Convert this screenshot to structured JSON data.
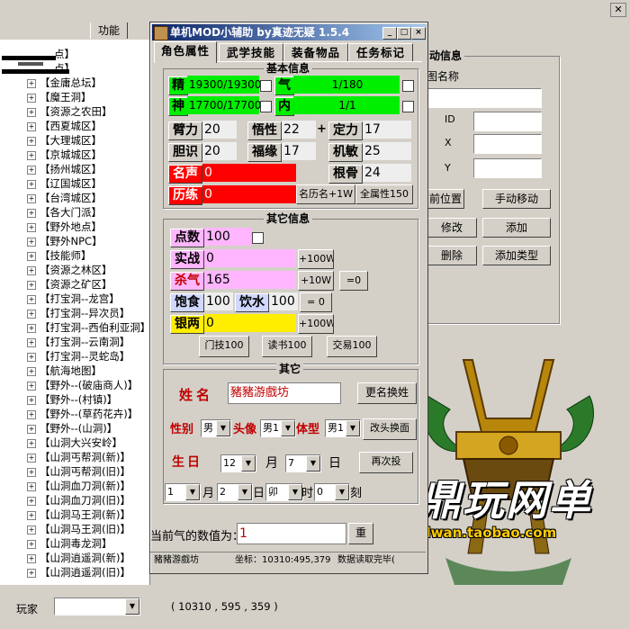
{
  "background_app": {
    "menu": {
      "func_tab": "功能"
    },
    "tree_items": [
      "点】",
      "点】",
      "【金庸总坛】",
      "【魔王洞】",
      "【资源之农田】",
      "【西夏城区】",
      "【大理城区】",
      "【京城城区】",
      "【扬州城区】",
      "【辽国城区】",
      "【台湾城区】",
      "【各大门派】",
      "【野外地点】",
      "【野外NPC】",
      "【技能师】",
      "【资源之林区】",
      "【资源之矿区】",
      "【打宝洞--龙宫】",
      "【打宝洞--异次员】",
      "【打宝洞--西伯利亚洞】",
      "【打宝洞--云南洞】",
      "【打宝洞--灵蛇岛】",
      "【航海地图】",
      "【野外--(破庙商人)】",
      "【野外--(村镇)】",
      "【野外--(草药花卉)】",
      "【野外--(山洞)】",
      "【山洞大兴安岭】",
      "【山洞丐帮洞(新)】",
      "【山洞丐帮洞(旧)】",
      "【山洞血刀洞(新)】",
      "【山洞血刀洞(旧)】",
      "【山洞马王洞(新)】",
      "【山洞马王洞(旧)】",
      "【山洞毒龙洞】",
      "【山洞逍遥洞(新)】",
      "【山洞逍遥洞(旧)】"
    ],
    "right_panel": {
      "group_title": "动信息",
      "name_label": "图名称",
      "id_label": "ID",
      "x_label": "X",
      "y_label": "Y",
      "btn_current_pos": "前位置",
      "btn_manual_move": "手动移动",
      "btn_modify": "修改",
      "btn_add": "添加",
      "btn_delete": "删除",
      "btn_add_type": "添加类型"
    },
    "bottom": {
      "player_label": "玩家",
      "coords": "( 10310 , 595 , 359 )"
    }
  },
  "dialog": {
    "title": "单机MOD小辅助 by真迹无疑 1.5.4",
    "tabs": [
      "角色属性",
      "武学技能",
      "装备物品",
      "任务标记"
    ],
    "basic": {
      "title": "基本信息",
      "jing_label": "精",
      "jing_value": "19300/19300",
      "qi_label": "气",
      "qi_value": "1/180",
      "shen_label": "神",
      "shen_value": "17700/17700",
      "nei_label": "内",
      "nei_value": "1/1",
      "stats": [
        {
          "label": "臂力",
          "value": "20"
        },
        {
          "label": "悟性",
          "value": "22"
        },
        {
          "label": "定力",
          "value": "17"
        },
        {
          "label": "胆识",
          "value": "20"
        },
        {
          "label": "福缘",
          "value": "17"
        },
        {
          "label": "机敏",
          "value": "25"
        }
      ],
      "plus_sign": "+",
      "fame_label": "名声",
      "fame_value": "0",
      "bone_label": "根骨",
      "bone_value": "24",
      "exp_label": "历练",
      "exp_value": "0",
      "btn_fame_exp": "名历名+1W",
      "btn_all_attr": "全属性150"
    },
    "other": {
      "title": "其它信息",
      "points_label": "点数",
      "points_value": "100",
      "combat_label": "实战",
      "combat_value": "0",
      "btn_combat": "+100W",
      "kill_label": "杀气",
      "kill_value": "165",
      "btn_kill": "+10W",
      "btn_kill_zero": "=0",
      "food_label": "饱食",
      "food_value": "100",
      "water_label": "饮水",
      "water_value": "100",
      "btn_food_zero": "= 0",
      "silver_label": "银两",
      "silver_value": "0",
      "btn_silver": "+100W",
      "btn_school": "门技100",
      "btn_read": "读书100",
      "btn_trade": "交易100"
    },
    "misc": {
      "title": "其它",
      "name_label": "姓名",
      "name_value": "豬豬游戲坊",
      "btn_rename": "更名换姓",
      "gender_label": "性别",
      "gender_value": "男",
      "avatar_label": "头像",
      "avatar_value": "男1",
      "body_label": "体型",
      "body_value": "男1",
      "btn_change_face": "改头换面",
      "birth_label": "生日",
      "month_value": "12",
      "month_unit": "月",
      "day_value": "7",
      "day_unit": "日",
      "btn_rebirth": "再次投",
      "sel_a": "1",
      "unit_month": "月",
      "sel_b": "2",
      "unit_day": "日",
      "sel_c": "卯",
      "unit_hour": "时",
      "sel_d": "0",
      "unit_ke": "刻"
    },
    "current_qi_label": "当前气的数值为：",
    "current_qi_value": "1",
    "btn_reset": "重",
    "status_bar": {
      "left": "豬豬游戲坊",
      "mid": "坐标：10310:495,379",
      "right": "数据读取完毕("
    }
  },
  "watermark": {
    "brand": "飓鼎玩网单",
    "url": "http://jdwan.taobao.com"
  },
  "colors": {
    "green": "#00ee00",
    "red": "#ff0000",
    "pink": "#ffb6ff",
    "yellow": "#ffee00",
    "title_blue": "#0a246a"
  }
}
